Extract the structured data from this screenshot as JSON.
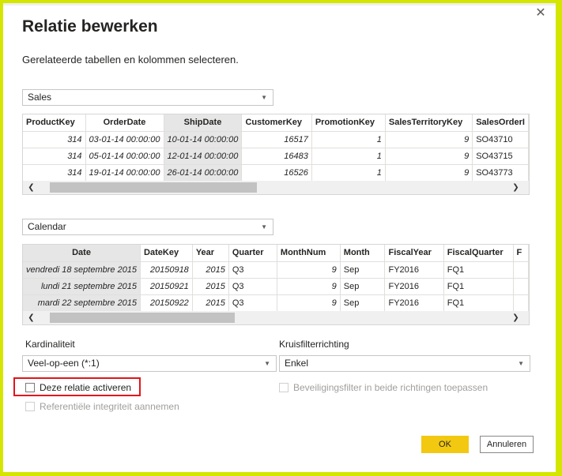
{
  "dialog": {
    "title": "Relatie bewerken",
    "subtitle": "Gerelateerde tabellen en kolommen selecteren.",
    "close_icon": "close-icon"
  },
  "table1": {
    "selected": "Sales",
    "columns": [
      "ProductKey",
      "OrderDate",
      "ShipDate",
      "CustomerKey",
      "PromotionKey",
      "SalesTerritoryKey",
      "SalesOrderI"
    ],
    "rows": [
      [
        "314",
        "03-01-14 00:00:00",
        "10-01-14 00:00:00",
        "16517",
        "1",
        "9",
        "SO43710"
      ],
      [
        "314",
        "05-01-14 00:00:00",
        "12-01-14 00:00:00",
        "16483",
        "1",
        "9",
        "SO43715"
      ],
      [
        "314",
        "19-01-14 00:00:00",
        "26-01-14 00:00:00",
        "16526",
        "1",
        "9",
        "SO43773"
      ]
    ]
  },
  "table2": {
    "selected": "Calendar",
    "columns": [
      "Date",
      "DateKey",
      "Year",
      "Quarter",
      "MonthNum",
      "Month",
      "FiscalYear",
      "FiscalQuarter",
      "F"
    ],
    "rows": [
      [
        "vendredi 18 septembre 2015",
        "20150918",
        "2015",
        "Q3",
        "9",
        "Sep",
        "FY2016",
        "FQ1",
        ""
      ],
      [
        "lundi 21 septembre 2015",
        "20150921",
        "2015",
        "Q3",
        "9",
        "Sep",
        "FY2016",
        "FQ1",
        ""
      ],
      [
        "mardi 22 septembre 2015",
        "20150922",
        "2015",
        "Q3",
        "9",
        "Sep",
        "FY2016",
        "FQ1",
        ""
      ]
    ]
  },
  "cardinality": {
    "label": "Kardinaliteit",
    "value": "Veel-op-een (*:1)"
  },
  "crossfilter": {
    "label": "Kruisfilterrichting",
    "value": "Enkel"
  },
  "options": {
    "activate": "Deze relatie activeren",
    "security_filter": "Beveiligingsfilter in beide richtingen toepassen",
    "referential": "Referentiële integriteit aannemen"
  },
  "buttons": {
    "ok": "OK",
    "cancel": "Annuleren"
  },
  "colors": {
    "accent": "#f2c811",
    "highlight": "#e3141b",
    "frame": "#d4e600"
  }
}
